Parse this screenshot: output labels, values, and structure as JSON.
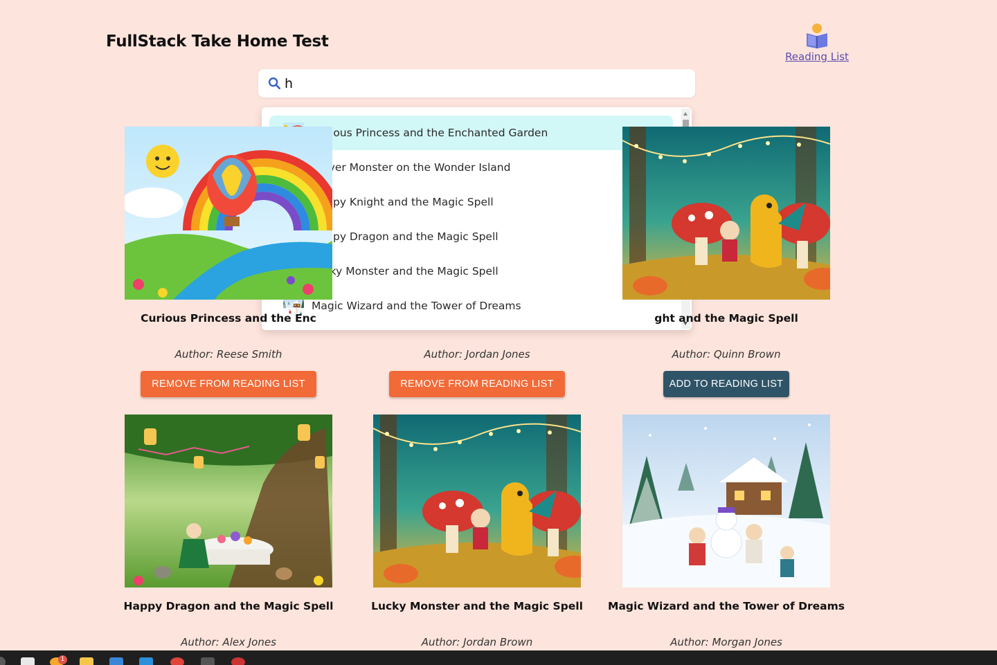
{
  "header": {
    "title": "FullStack Take Home Test",
    "reading_list_label": "Reading List"
  },
  "search": {
    "value": "h",
    "placeholder": ""
  },
  "dropdown": {
    "items": [
      {
        "label": "Curious Princess and the Enchanted Garden",
        "thumb": "rainbow"
      },
      {
        "label": "Clever Monster on the Wonder Island",
        "thumb": "forest"
      },
      {
        "label": "Happy Knight and the Magic Spell",
        "thumb": "forest"
      },
      {
        "label": "Happy Dragon and the Magic Spell",
        "thumb": "garden"
      },
      {
        "label": "Lucky Monster and the Magic Spell",
        "thumb": "forest"
      },
      {
        "label": "Magic Wizard and the Tower of Dreams",
        "thumb": "snow"
      }
    ]
  },
  "books": [
    {
      "title": "Curious Princess and the Enc",
      "author": "Author: Reese Smith",
      "button": "REMOVE FROM READING LIST",
      "action": "remove",
      "scene": "rainbow"
    },
    {
      "title": "",
      "author": "Author: Jordan Jones",
      "button": "REMOVE FROM READING LIST",
      "action": "remove",
      "scene": "hidden"
    },
    {
      "title": "ght and the Magic Spell",
      "author": "Author: Quinn Brown",
      "button": "ADD TO READING LIST",
      "action": "add",
      "scene": "forest"
    },
    {
      "title": "Happy Dragon and the Magic Spell",
      "author": "Author: Alex Jones",
      "button": "",
      "action": "",
      "scene": "garden"
    },
    {
      "title": "Lucky Monster and the Magic Spell",
      "author": "Author: Jordan Brown",
      "button": "",
      "action": "",
      "scene": "forest"
    },
    {
      "title": "Magic Wizard and the Tower of Dreams",
      "author": "Author: Morgan Jones",
      "button": "",
      "action": "",
      "scene": "snow"
    }
  ],
  "taskbar": {
    "notification_count": "1"
  },
  "colors": {
    "page_background": "#fde4dc",
    "remove_button": "#f26a38",
    "add_button": "#2f5468",
    "dropdown_highlight": "#d2f7f7",
    "link": "#5b4bb0"
  }
}
